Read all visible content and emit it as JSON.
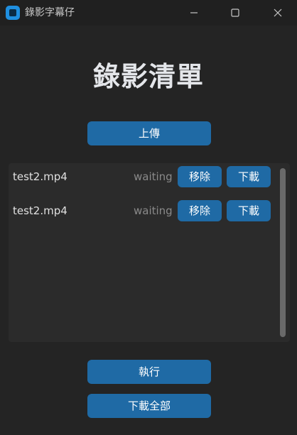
{
  "window": {
    "title": "錄影字幕仔",
    "controls": [
      "minimize-icon",
      "maximize-icon",
      "close-icon"
    ]
  },
  "heading": "錄影清單",
  "buttons": {
    "upload": "上傳",
    "run": "執行",
    "download_all": "下載全部"
  },
  "list": {
    "items": [
      {
        "name": "test2.mp4",
        "status": "waiting",
        "remove_label": "移除",
        "download_label": "下載"
      },
      {
        "name": "test2.mp4",
        "status": "waiting",
        "remove_label": "移除",
        "download_label": "下載"
      }
    ]
  },
  "colors": {
    "background": "#242424",
    "titlebar": "#202020",
    "panel": "#2b2b2b",
    "accent": "#1f6aa5",
    "status_text": "#8a8a8a"
  }
}
